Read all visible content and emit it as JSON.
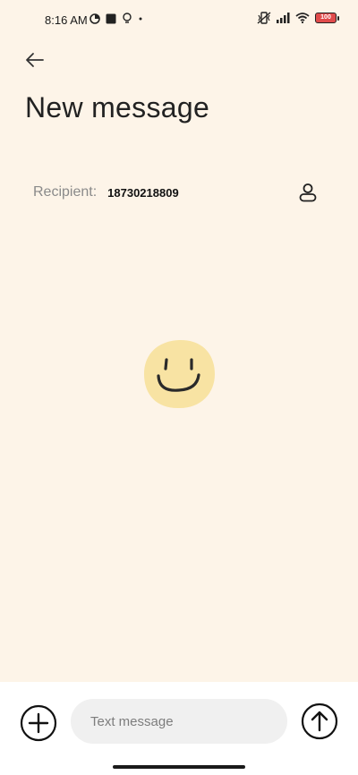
{
  "status_bar": {
    "time": "8:16 AM",
    "battery": "100",
    "icons_left": [
      "data-saver-icon",
      "square-notification-icon",
      "bulb-icon",
      "dot-icon"
    ],
    "icons_right": [
      "vibrate-icon",
      "signal-icon",
      "wifi-icon",
      "battery-icon"
    ]
  },
  "header": {
    "back_icon": "arrow-left-icon",
    "title": "New message"
  },
  "recipient": {
    "label": "Recipient:",
    "value": "18730218809",
    "contact_icon": "person-icon"
  },
  "empty_state": {
    "icon": "smiley-face-icon",
    "color": "#f8e3a3"
  },
  "composer": {
    "add_icon": "plus-circle-icon",
    "placeholder": "Text message",
    "value": "",
    "send_icon": "arrow-up-circle-icon"
  }
}
